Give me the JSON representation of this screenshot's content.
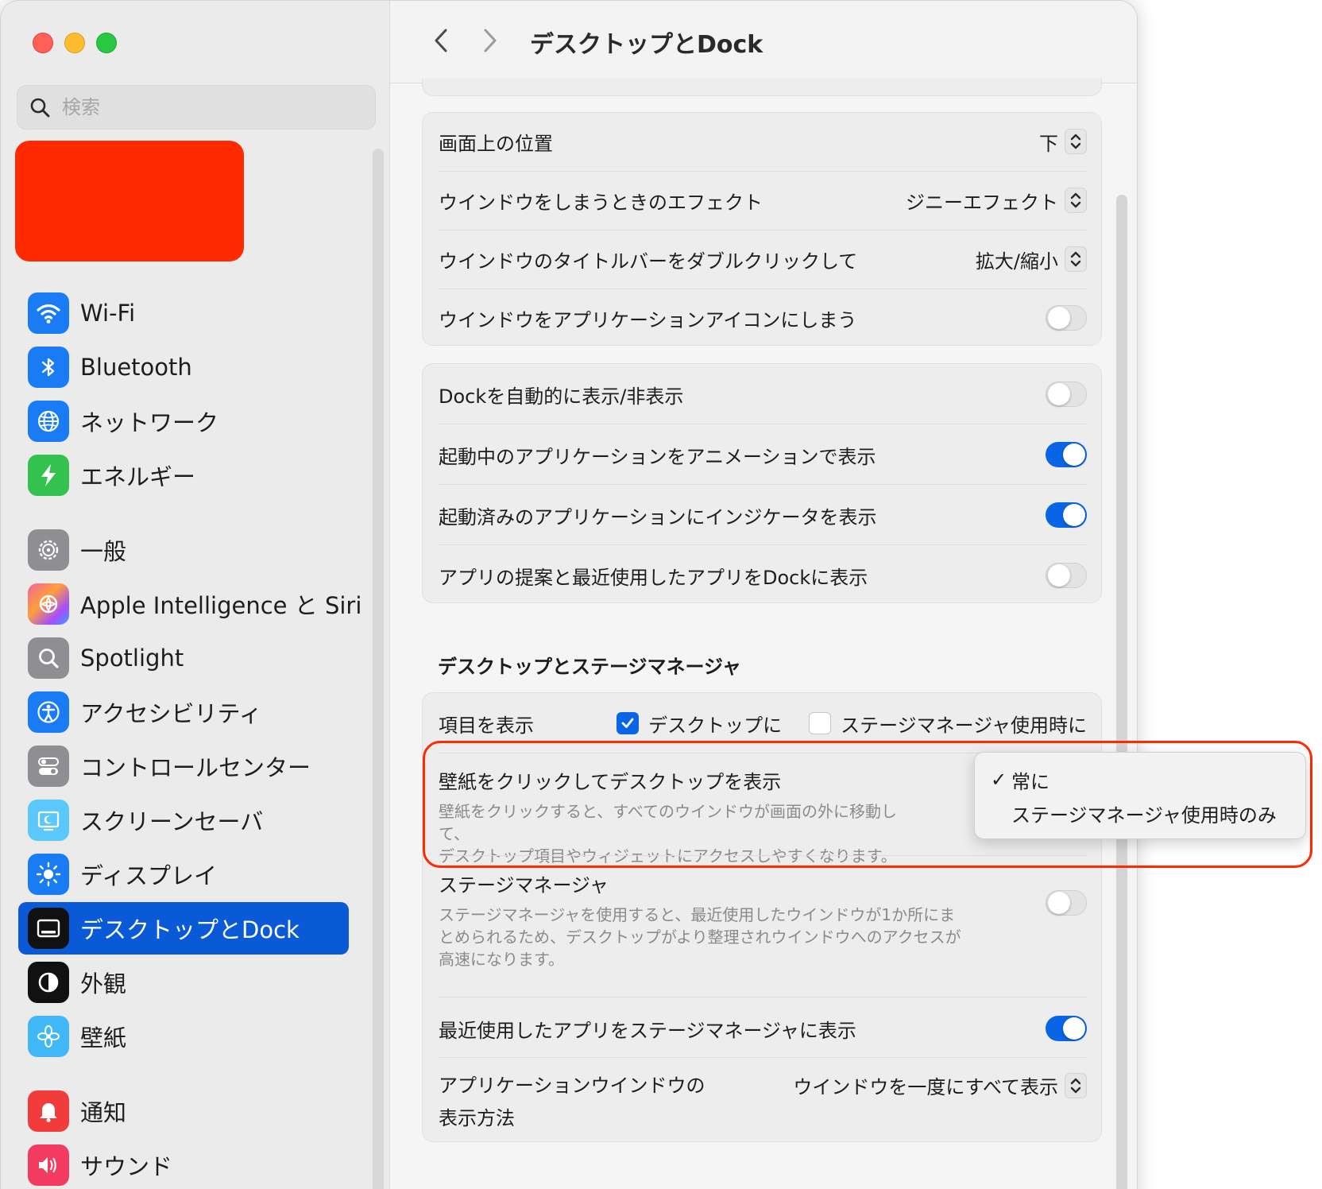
{
  "window": {
    "title": "デスクトップとDock"
  },
  "search": {
    "placeholder": "検索"
  },
  "sidebar": {
    "items": [
      {
        "label": "Wi-Fi"
      },
      {
        "label": "Bluetooth"
      },
      {
        "label": "ネットワーク"
      },
      {
        "label": "エネルギー"
      },
      {
        "label": "一般"
      },
      {
        "label": "Apple Intelligence と Siri"
      },
      {
        "label": "Spotlight"
      },
      {
        "label": "アクセシビリティ"
      },
      {
        "label": "コントロールセンター"
      },
      {
        "label": "スクリーンセーバ"
      },
      {
        "label": "ディスプレイ"
      },
      {
        "label": "デスクトップとDock"
      },
      {
        "label": "外観"
      },
      {
        "label": "壁紙"
      },
      {
        "label": "通知"
      },
      {
        "label": "サウンド"
      }
    ],
    "selected": "デスクトップとDock"
  },
  "dock_group": {
    "position": {
      "label": "画面上の位置",
      "value": "下"
    },
    "minimize_effect": {
      "label": "ウインドウをしまうときのエフェクト",
      "value": "ジニーエフェクト"
    },
    "titlebar_double_click": {
      "label": "ウインドウのタイトルバーをダブルクリックして",
      "value": "拡大/縮小"
    },
    "minimize_to_icon": {
      "label": "ウインドウをアプリケーションアイコンにしまう",
      "on": false
    }
  },
  "dock_group2": {
    "autohide": {
      "label": "Dockを自動的に表示/非表示",
      "on": false
    },
    "animate": {
      "label": "起動中のアプリケーションをアニメーションで表示",
      "on": true
    },
    "indicators": {
      "label": "起動済みのアプリケーションにインジケータを表示",
      "on": true
    },
    "suggestions": {
      "label": "アプリの提案と最近使用したアプリをDockに表示",
      "on": false
    }
  },
  "stage_section": {
    "title": "デスクトップとステージマネージャ",
    "show_items": {
      "label": "項目を表示",
      "desktop": {
        "label": "デスクトップに",
        "checked": true
      },
      "stage": {
        "label": "ステージマネージャ使用時に",
        "checked": false
      }
    },
    "click_wallpaper": {
      "label": "壁紙をクリックしてデスクトップを表示",
      "desc1": "壁紙をクリックすると、すべてのウインドウが画面の外に移動して、",
      "desc2": "デスクトップ項目やウィジェットにアクセスしやすくなります。",
      "menu": {
        "checkmark": "✓",
        "options": [
          "常に",
          "ステージマネージャ使用時のみ"
        ],
        "selected": "常に"
      }
    },
    "stage_manager": {
      "label": "ステージマネージャ",
      "desc1": "ステージマネージャを使用すると、最近使用したウインドウが1か所にま",
      "desc2": "とめられるため、デスクトップがより整理されウインドウへのアクセスが",
      "desc3": "高速になります。",
      "on": false
    },
    "recent_apps": {
      "label": "最近使用したアプリをステージマネージャに表示",
      "on": true
    },
    "app_windows": {
      "label1": "アプリケーションウインドウの",
      "label2": "表示方法",
      "value": "ウインドウを一度にすべて表示"
    }
  },
  "colors": {
    "accent": "#0a65e6",
    "selected_sidebar": "#0a5ad7",
    "highlight": "#ff2a00",
    "redacted_block": "#ff2a00"
  },
  "icons": {
    "wifi": "wifi-icon",
    "bluetooth": "bluetooth-icon",
    "network": "globe-icon",
    "energy": "bolt-icon",
    "general": "gear-icon",
    "siri": "siri-icon",
    "spotlight": "magnifier-icon",
    "accessibility": "accessibility-icon",
    "control_center": "toggles-icon",
    "screensaver": "screensaver-icon",
    "display": "sun-icon",
    "desktop_dock": "dock-icon",
    "appearance": "appearance-icon",
    "wallpaper": "flower-icon",
    "notifications": "bell-icon",
    "sound": "speaker-icon"
  }
}
